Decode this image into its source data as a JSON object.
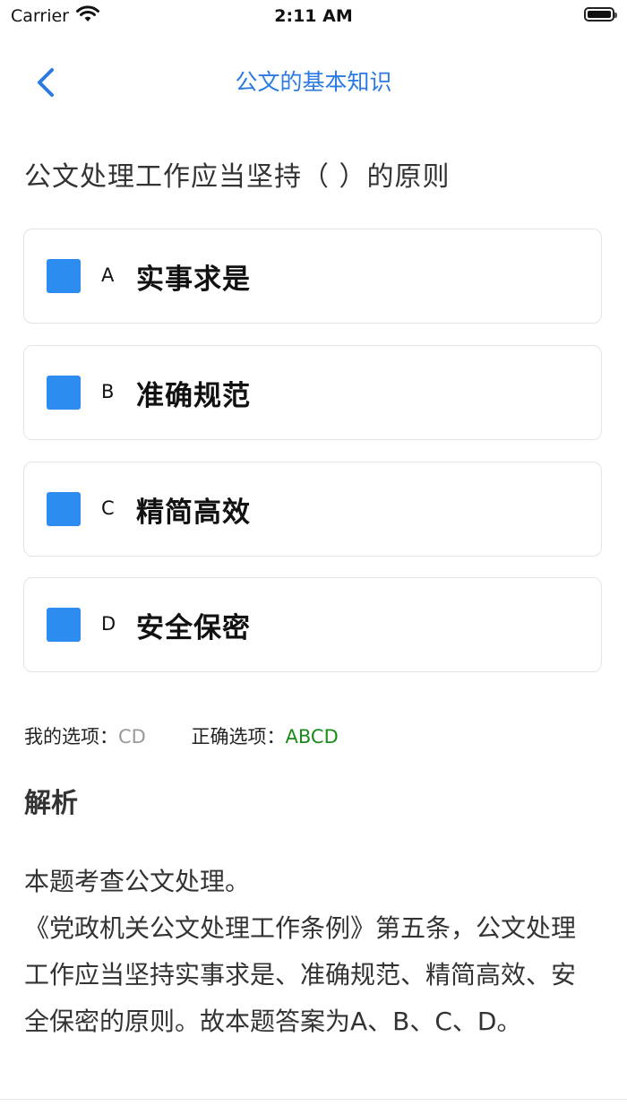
{
  "status_bar": {
    "carrier": "Carrier",
    "time": "2:11 AM",
    "icons": [
      "wifi-icon",
      "battery-icon"
    ]
  },
  "nav": {
    "title": "公文的基本知识",
    "back_icon": "chevron-left-icon",
    "accent_color": "#2a7ae2"
  },
  "question": {
    "text": "公文处理工作应当坚持（ ）的原则"
  },
  "options": [
    {
      "letter": "A",
      "text": "实事求是"
    },
    {
      "letter": "B",
      "text": "准确规范"
    },
    {
      "letter": "C",
      "text": "精简高效"
    },
    {
      "letter": "D",
      "text": "安全保密"
    }
  ],
  "answers": {
    "my_label": "我的选项：",
    "my_value": "CD",
    "correct_label": "正确选项：",
    "correct_value": "ABCD",
    "my_color": "#999999",
    "correct_color": "#1a8c1a"
  },
  "analysis": {
    "heading": "解析",
    "line1": "本题考查公文处理。",
    "line2": "《党政机关公文处理工作条例》第五条，公文处理工作应当坚持实事求是、准确规范、精简高效、安全保密的原则。故本题答案为A、B、C、D。"
  },
  "colors": {
    "checkbox": "#2d8cf0",
    "card_border": "#e4e4e4"
  }
}
